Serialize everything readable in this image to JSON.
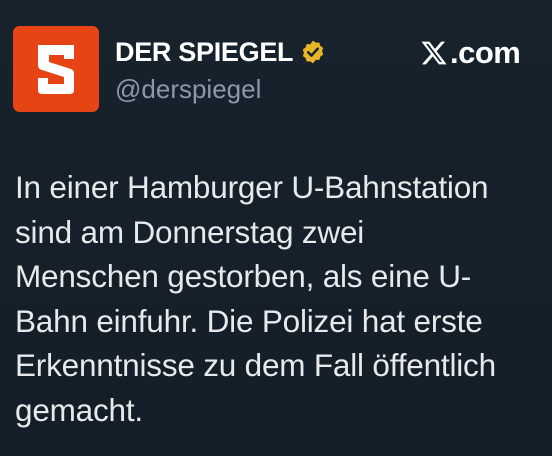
{
  "post": {
    "author": {
      "display_name": "DER SPIEGEL",
      "handle": "@derspiegel",
      "verified": true,
      "avatar_letter": "S",
      "avatar_color": "#e64415"
    },
    "source": {
      "label": ".com",
      "icon": "x-logo-icon"
    },
    "text_lines": [
      "In einer Hamburger U-Bahnstation",
      "sind am Donnerstag zwei",
      "Menschen gestorben, als eine U-",
      "Bahn einfuhr. Die Polizei hat erste",
      "Erkenntnisse zu dem Fall öffentlich",
      "gemacht."
    ]
  },
  "colors": {
    "background": "#15202b",
    "text_primary": "#e7e9ea",
    "text_secondary": "#8b98a5",
    "verified_badge": "#e8b529"
  }
}
